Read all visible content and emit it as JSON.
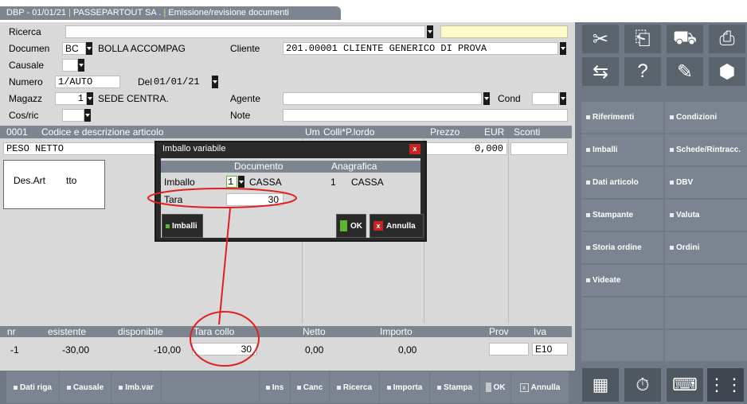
{
  "title_bar": {
    "part1": "DBP - 01/01/21",
    "part2": "PASSEPARTOUT SA .",
    "part3": "Emissione/revisione documenti"
  },
  "form": {
    "ricerca_label": "Ricerca",
    "documen_label": "Documen",
    "documen_code": "BC",
    "documen_desc": "BOLLA ACCOMPAG",
    "cliente_label": "Cliente",
    "cliente_value": "201.00001 CLIENTE GENERICO DI PROVA",
    "causale_label": "Causale",
    "numero_label": "Numero",
    "numero_value": "1/AUTO",
    "del_label": "Del",
    "del_value": "01/01/21",
    "magazz_label": "Magazz",
    "magazz_value": "1",
    "magazz_desc": "SEDE CENTRA.",
    "agente_label": "Agente",
    "cond_label": "Cond",
    "cosric_label": "Cos/ric",
    "note_label": "Note"
  },
  "grid": {
    "headers": [
      "0001",
      "Codice e descrizione articolo",
      "Um",
      "Colli*P.lordo",
      "Prezzo",
      "EUR",
      "Sconti"
    ],
    "row_desc": "PESO NETTO",
    "row_prezzo": "0,000",
    "desart_label": "Des.Art",
    "desart_value": "tto"
  },
  "dialog": {
    "title": "Imballo variabile",
    "col_documento": "Documento",
    "col_anagrafica": "Anagrafica",
    "imballo_label": "Imballo",
    "imballo_value": "1",
    "imballo_doc_desc": "CASSA",
    "imballo_anag_num": "1",
    "imballo_anag_desc": "CASSA",
    "tara_label": "Tara",
    "tara_value": "30",
    "imballi_btn": "Imballi",
    "ok_btn": "OK",
    "annulla_btn": "Annulla"
  },
  "footer_row": {
    "labels": [
      "nr",
      "esistente",
      "disponibile",
      "Tara collo",
      "Netto",
      "Importo",
      "Prov",
      "Iva"
    ],
    "values": [
      "-1",
      "-30,00",
      "-10,00",
      "30",
      "0,00",
      "0,00",
      "",
      "E10"
    ]
  },
  "side_buttons": [
    [
      "Riferimenti",
      "Condizioni"
    ],
    [
      "Imballi",
      "Schede/Rintracc."
    ],
    [
      "Dati articolo",
      "DBV"
    ],
    [
      "Stampante",
      "Valuta"
    ],
    [
      "Storia ordine",
      "Ordini"
    ],
    [
      "Videate",
      ""
    ]
  ],
  "bottom_buttons": [
    "Dati riga",
    "Causale",
    "Imb.var",
    "Ins",
    "Canc",
    "Ricerca",
    "Importa",
    "Stampa",
    "OK",
    "Annulla"
  ],
  "colors": {
    "accent_red": "#e02020",
    "highlight": "#5bb82c"
  }
}
